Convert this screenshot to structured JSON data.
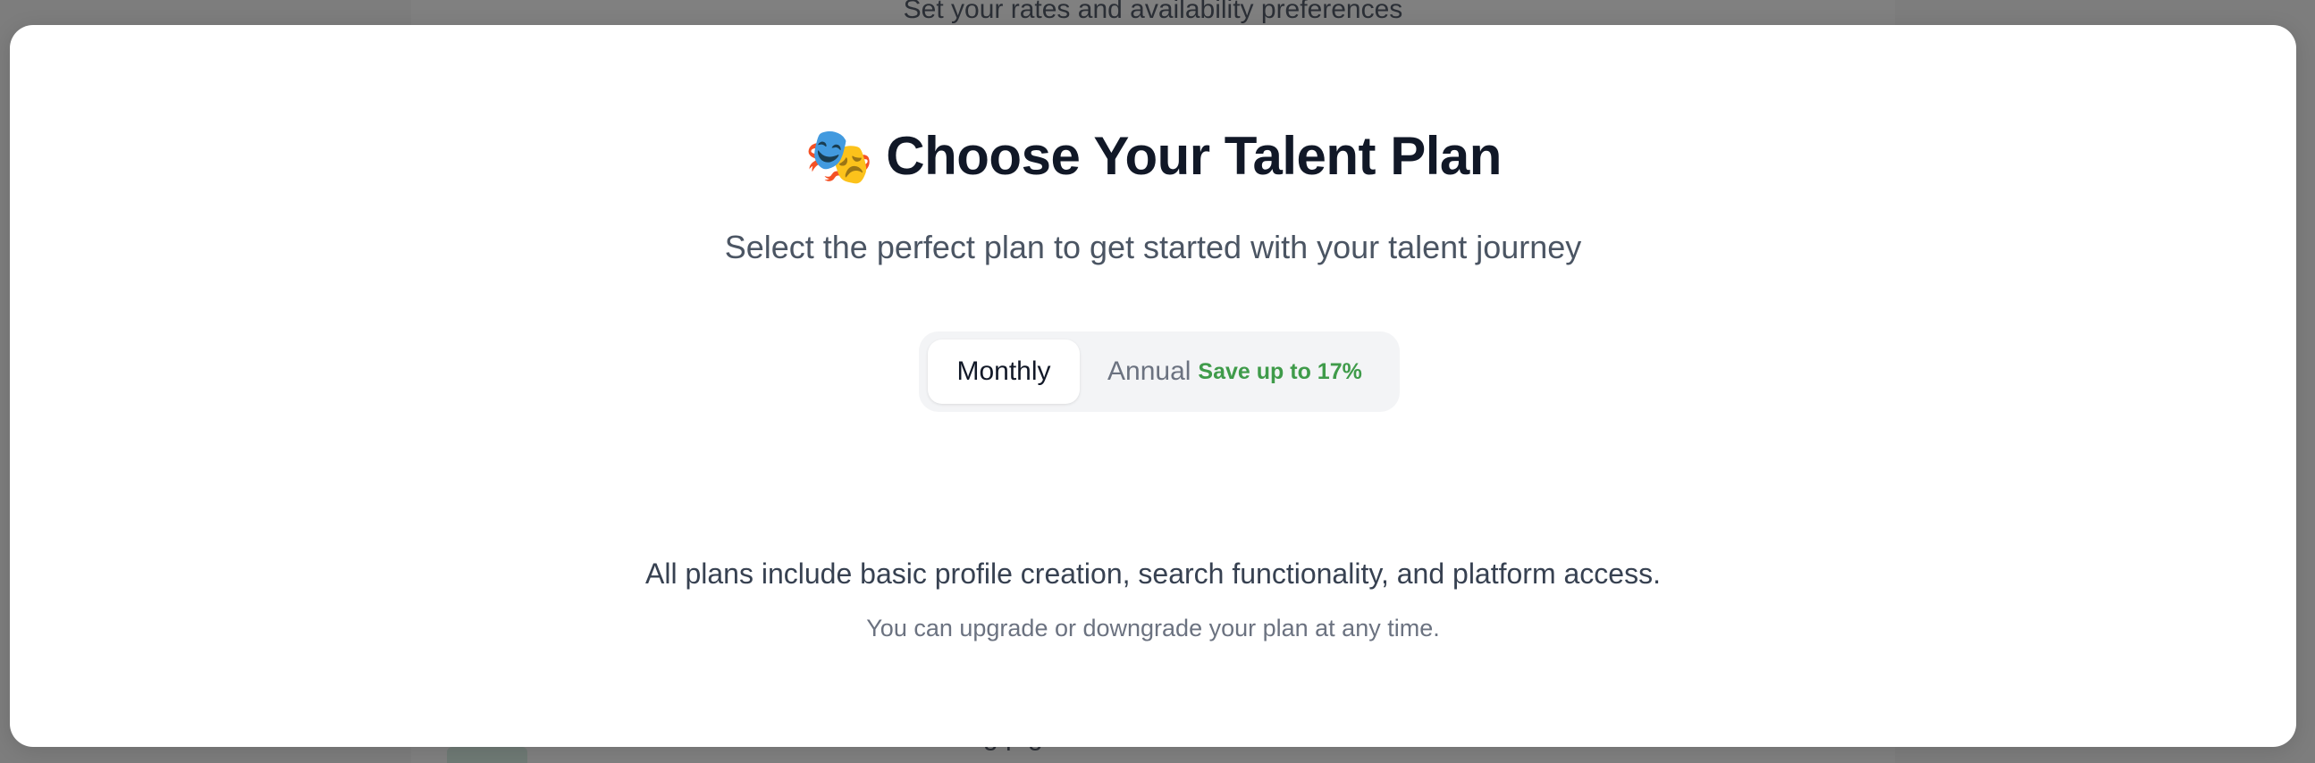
{
  "background": {
    "top_text": "Set your rates and availability preferences",
    "bottom_text": "g            p    g"
  },
  "modal": {
    "emoji": "🎭",
    "title": "Choose Your Talent Plan",
    "subtitle": "Select the perfect plan to get started with your talent journey",
    "billing_toggle": {
      "monthly_label": "Monthly",
      "annual_label": "Annual",
      "annual_badge": "Save up to 17%",
      "selected": "Monthly"
    },
    "footer": {
      "main": "All plans include basic profile creation, search functionality, and platform access.",
      "sub": "You can upgrade or downgrade your plan at any time."
    }
  },
  "colors": {
    "overlay": "#7d7d7d",
    "title": "#111827",
    "badge_green": "#3f9b4a",
    "toggle_bg": "#f3f4f6"
  }
}
